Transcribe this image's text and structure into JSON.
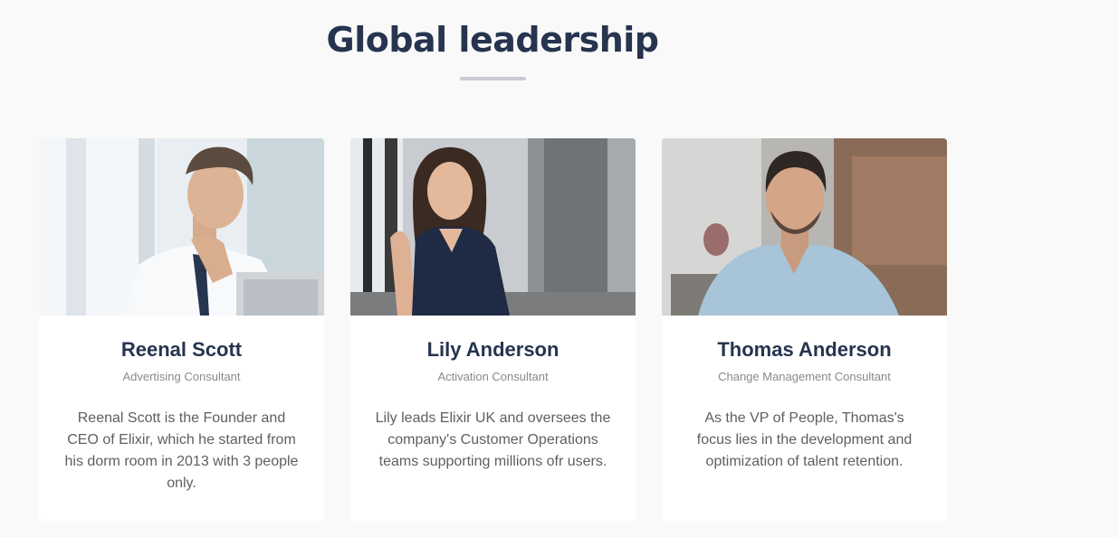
{
  "section": {
    "title": "Global leadership"
  },
  "team": [
    {
      "name": "Reenal Scott",
      "role": "Advertising Consultant",
      "bio": "Reenal Scott is the Founder and CEO of Elixir, which he started from his dorm room in 2013 with 3 people only."
    },
    {
      "name": "Lily Anderson",
      "role": "Activation Consultant",
      "bio": "Lily leads Elixir UK and oversees the company's Customer Operations teams supporting millions ofr users."
    },
    {
      "name": "Thomas Anderson",
      "role": "Change Management Consultant",
      "bio": "As the VP of People, Thomas's focus lies in the development and optimization of talent retention."
    }
  ]
}
